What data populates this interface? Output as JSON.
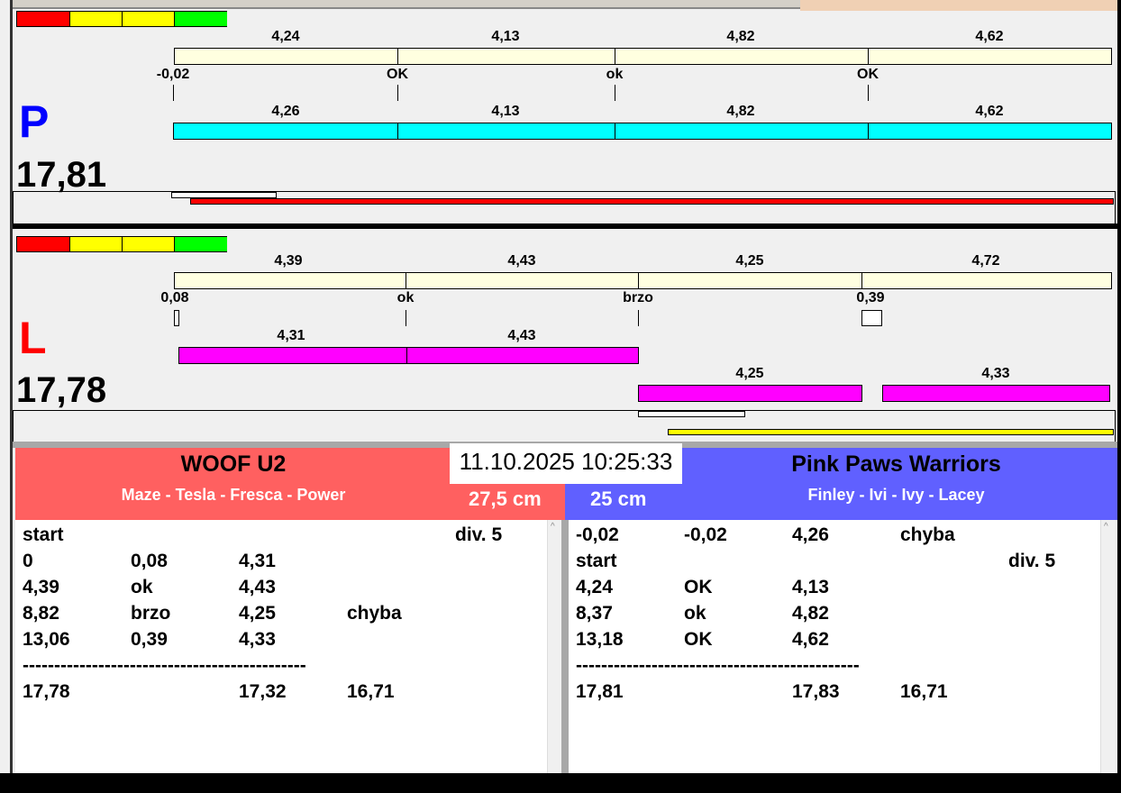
{
  "colors": {
    "red": "#ff0000",
    "yellow": "#ffff00",
    "green": "#00ff00",
    "cream": "#ffffe0",
    "cyan": "#00ffff",
    "magenta": "#ff00ff",
    "team_left": "#ff6060",
    "team_right": "#6060ff"
  },
  "p_panel": {
    "letter": "P",
    "total": "17,81",
    "top_bar_labels": [
      "4,24",
      "4,13",
      "4,82",
      "4,62"
    ],
    "split_labels": [
      "-0,02",
      "OK",
      "ok",
      "OK"
    ],
    "run_bar_labels": [
      "4,26",
      "4,13",
      "4,82",
      "4,62"
    ]
  },
  "l_panel": {
    "letter": "L",
    "total": "17,78",
    "top_bar_labels": [
      "4,39",
      "4,43",
      "4,25",
      "4,72"
    ],
    "split_labels": [
      "0,08",
      "ok",
      "brzo",
      "0,39"
    ],
    "run_bar_labels": [
      "4,31",
      "4,43",
      "4,25",
      "4,33"
    ]
  },
  "timestamp": "11.10.2025 10:25:33",
  "left_team": {
    "name": "WOOF U2",
    "dogs": "Maze - Tesla - Fresca - Power",
    "height": "27,5 cm",
    "rows": [
      [
        "start",
        "",
        "",
        "",
        "div.  5"
      ],
      [
        "0",
        "0,08",
        "4,31",
        "",
        ""
      ],
      [
        "4,39",
        "ok",
        "4,43",
        "",
        ""
      ],
      [
        "8,82",
        "brzo",
        "4,25",
        "chyba",
        ""
      ],
      [
        "13,06",
        "0,39",
        "4,33",
        "",
        ""
      ],
      [
        "---------------------------------------------",
        "",
        "",
        "",
        ""
      ],
      [
        "17,78",
        "",
        "17,32",
        "16,71",
        ""
      ]
    ]
  },
  "right_team": {
    "name": "Pink Paws Warriors",
    "dogs": "Finley - Ivi - Ivy - Lacey",
    "height": "25 cm",
    "rows": [
      [
        "-0,02",
        "-0,02",
        "4,26",
        "chyba",
        ""
      ],
      [
        "start",
        "",
        "",
        "",
        "div.  5"
      ],
      [
        "4,24",
        "OK",
        "4,13",
        "",
        ""
      ],
      [
        "8,37",
        "ok",
        "4,82",
        "",
        ""
      ],
      [
        "13,18",
        "OK",
        "4,62",
        "",
        ""
      ],
      [
        "---------------------------------------------",
        "",
        "",
        "",
        ""
      ],
      [
        "17,81",
        "",
        "17,83",
        "16,71",
        ""
      ]
    ]
  }
}
